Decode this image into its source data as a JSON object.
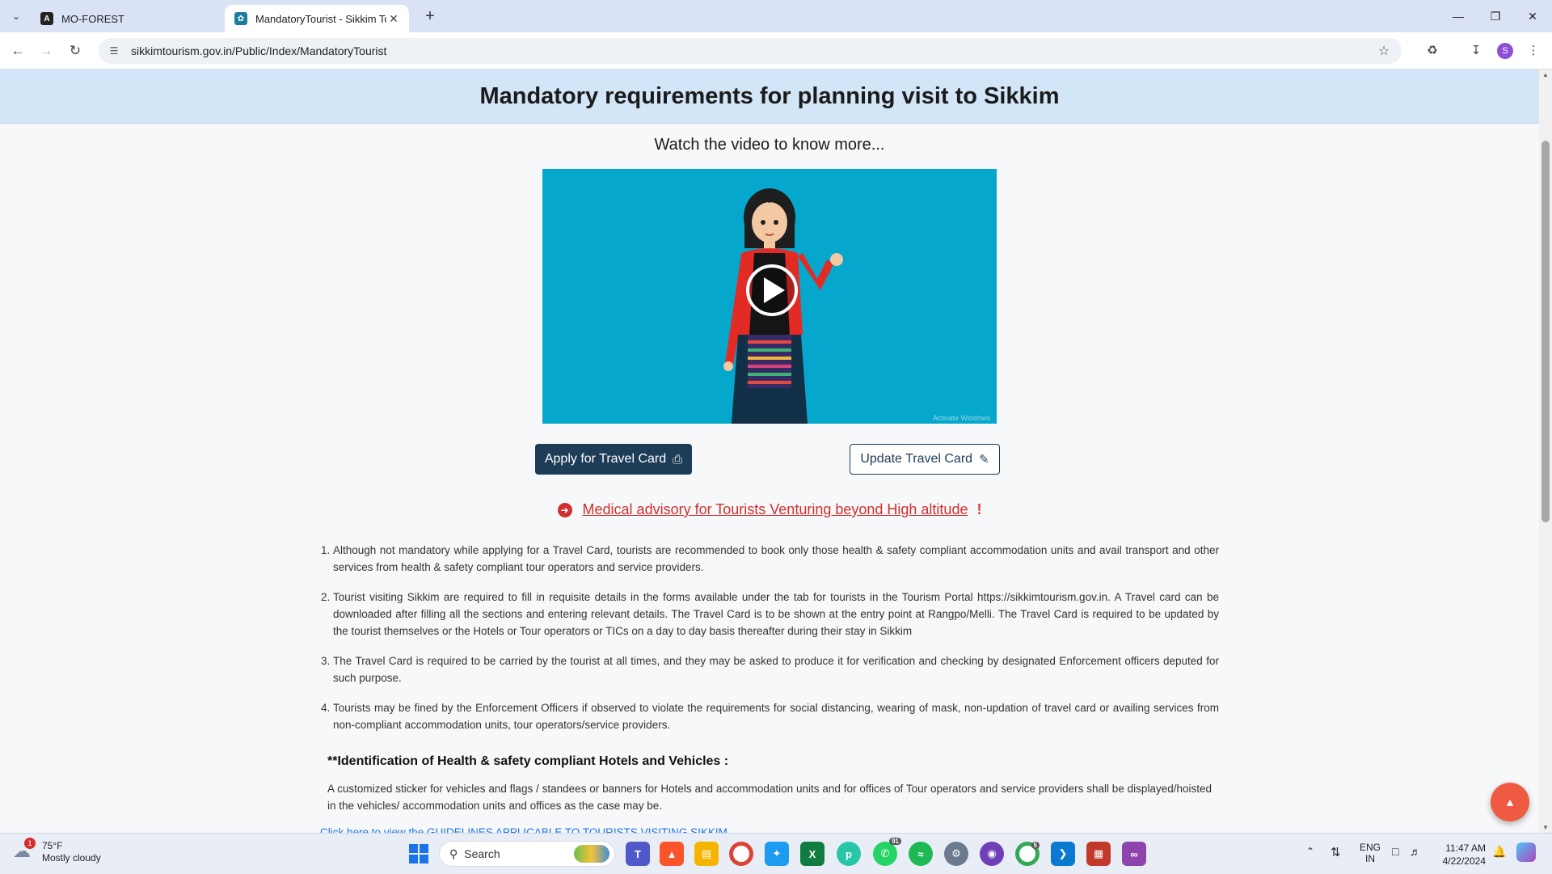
{
  "browser": {
    "tabs": [
      {
        "title": "MO-FOREST",
        "active": false
      },
      {
        "title": "MandatoryTourist - Sikkim Tou",
        "active": true
      }
    ],
    "url": "sikkimtourism.gov.in/Public/Index/MandatoryTourist",
    "profile_initial": "S"
  },
  "page": {
    "title": "Mandatory requirements for planning visit to Sikkim",
    "video_prompt": "Watch the video to know more...",
    "video_watermark": "Activate Windows",
    "apply_button": "Apply for Travel Card",
    "update_button": "Update Travel Card",
    "advisory_link": "Medical advisory for Tourists Venturing beyond High altitude",
    "rules": [
      "Although not mandatory while applying for a Travel Card, tourists are recommended to book only those health & safety compliant accommodation units and avail transport and other services from health & safety compliant tour operators and service providers.",
      "Tourist visiting Sikkim are required to fill in requisite details in the forms available under the tab for tourists in the Tourism Portal https://sikkimtourism.gov.in. A Travel card can be downloaded after filling all the sections and entering relevant details. The Travel Card is to be shown at the entry point at Rangpo/Melli. The Travel Card is required to be updated by the tourist themselves or the Hotels or Tour operators or TICs on a day to day basis thereafter during their stay in Sikkim",
      "The Travel Card is required to be carried by the tourist at all times, and they may be asked to produce it for verification and checking by designated Enforcement officers deputed for such purpose.",
      "Tourists may be fined by the Enforcement Officers if observed to violate the requirements for social distancing, wearing of mask, non-updation of travel card or availing services from non-compliant accommodation units, tour operators/service providers."
    ],
    "identification_heading": "**Identification of Health & safety compliant Hotels and Vehicles :",
    "identification_text": "A customized sticker for vehicles and flags / standees or banners for Hotels and accommodation units and for offices of Tour operators and service providers shall be displayed/hoisted in the vehicles/ accommodation units and offices as the case may be.",
    "guidelines_link": "Click here to view the GUIDELINES APPLICABLE TO TOURISTS VISITING SIKKIM"
  },
  "taskbar": {
    "weather_temp": "75°F",
    "weather_desc": "Mostly cloudy",
    "weather_badge": "1",
    "search_placeholder": "Search",
    "whatsapp_count": "91",
    "chrome_count": "5",
    "lang_top": "ENG",
    "lang_bottom": "IN",
    "time": "11:47 AM",
    "date": "4/22/2024"
  },
  "colors": {
    "header_band": "#d3e6f7",
    "primary_button": "#1d3c58",
    "advisory": "#d32f2f",
    "video_bg": "#06a7cc",
    "scroll_top_button": "#ef5b42"
  }
}
